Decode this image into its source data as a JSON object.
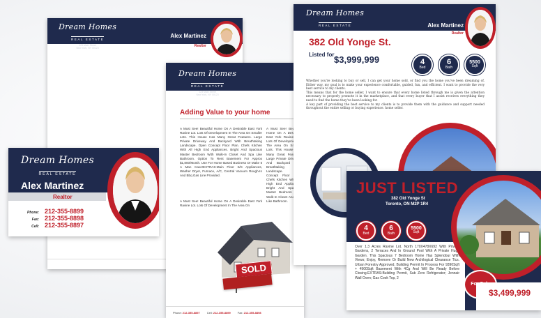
{
  "brand": {
    "logo_main": "Dream Homes",
    "logo_sub": "REAL ESTATE",
    "address_small": "123 Main Street\nNew York, NY 00123"
  },
  "agent": {
    "name": "Alex Martinez",
    "title": "Realtor",
    "phone_label": "Phone:",
    "phone": "212-355-8899",
    "fax_label": "Fax:",
    "fax": "212-355-8898",
    "cell_label": "Cell:",
    "cell": "212-355-8897"
  },
  "footer": {
    "phone": "212-355-8897",
    "cell": "212-355-8899",
    "fax": "212-355-8898",
    "email": "yourname@email.com",
    "web": "www.yourwebsite.com"
  },
  "letter": {
    "heading": "Adding Value to your home",
    "col1": "A Must See! Beautiful Home On A Desirable East York Ravine Lot. Lots Of Development In The Area On Smaller Lots. This House Has Many Great Features. Large Private Driveway And Backyard With Breathtaking Landscape. Open Concept Floor Plan. Chefs Kitchen With All High End Appliances. Bright And Spacious Master Bedroom With Walk-In Closet And Spa Like Bathroom. Option To Rent Basement For Approx $1,800/Month. Use For Home Based Business Or Make It A Man Cave!EXTRAS:Main Floor S/S Appliances, Washer Dryer, Furnace, A/C, Central Vacuum Rough-In And Bbq Gas Line Provided.",
    "col1b": "A Must See! Beautiful Home On A Desirable East York Ravine Lot. Lots Of Development In The Area On",
    "col2": "A Must See! Beautiful Home On A Desirable East York Ravine Lot. Lots Of Development In The Area On Smaller Lots. This House Has Many Great Features. Large Private Driveway And Backyard With Breathtaking Landscape. Open Concept Floor Plan. Chefs Kitchen With All High End Appliances. Bright And Spacious Master Bedroom With Walk-In Closet And Spa Like Bathroom.",
    "sold_sign": "SOLD"
  },
  "listing": {
    "address": "382 Old Yonge St.",
    "listed_for_label": "Listed for",
    "price": "$3,999,999",
    "beds": "4",
    "beds_label": "Bed",
    "baths": "6",
    "baths_label": "Bath",
    "sqft": "5500",
    "sqft_label": "Sqft",
    "body": "Whether you're looking to buy or sell, I can get your home sold, or find you the home you've been dreaming of. Either way, my goal is to make your experience comfortable, guided, fun, and efficient. I want to provide the very best service to my clients.\nThis means that for the home seller, I want to ensure that every home listed through me is given the attention necessary to properly promote it in the marketplace, and that every buyer that I assist receives everything they need to find the home they've been looking for.\nA key part of providing the best service to my clients is to provide them with the guidance and support needed throughout the entire selling or buying experience. home seller."
  },
  "postcard": {
    "headline": "JUST LISTED",
    "address_line1": "382 Old Yonge St",
    "address_line2": "Toronto, ON M2P 1R4",
    "beds": "4",
    "beds_label": "Bed",
    "baths": "6",
    "baths_label": "Bath",
    "sqft": "5500",
    "sqft_label": "Sqft",
    "body": "Over 1.3 Acres Ravine Lot. North 170X478X692 With Private Gardens, 2 Terraces And In Ground Pool With A Private Huge Garden. This Spacious 7 Bedroom Home Has Splendour With Views; Enjoy, Remove Or Build New Archilogical Clearance Tics. Urban Forestry Approved, Building Permit In Process For 9390Sqft + 4900Sqft Basement With 4Cg And Will Be Ready Before Closing.EXTRAS:Building Permit, Sub Zero Refrigerator; Jennair Wall Oven; Gas Cook Top, 2",
    "for_sale": "For Sale",
    "price": "$3,499,999"
  },
  "colors": {
    "navy": "#1f2a4d",
    "red": "#c0202a"
  }
}
